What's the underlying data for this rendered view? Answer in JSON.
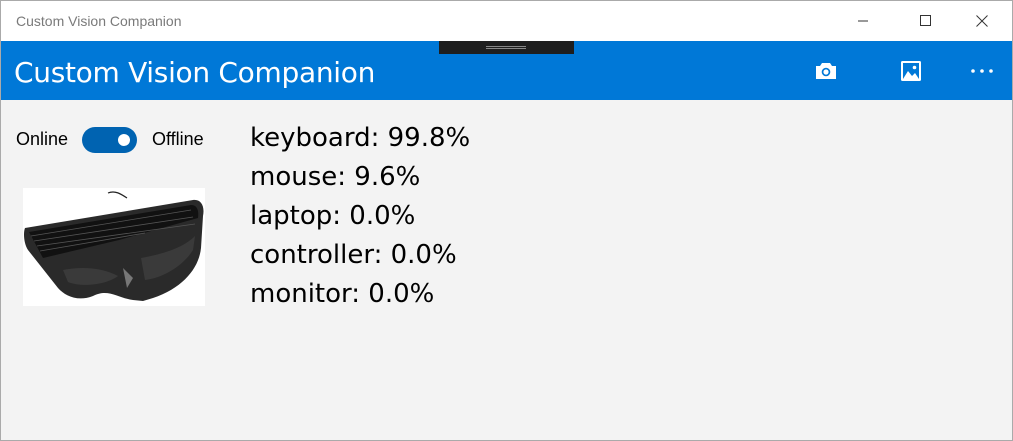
{
  "window": {
    "title": "Custom Vision Companion",
    "controls": {
      "minimize_icon": "minimize-icon",
      "maximize_icon": "maximize-icon",
      "close_icon": "close-icon"
    }
  },
  "appbar": {
    "title": "Custom Vision Companion",
    "accent": "#0078d7",
    "buttons": {
      "camera_icon": "camera-icon",
      "gallery_icon": "gallery-icon",
      "more_icon": "more-icon"
    }
  },
  "mode": {
    "online_label": "Online",
    "offline_label": "Offline",
    "toggle_on": true
  },
  "preview": {
    "image": "keyboard-image"
  },
  "results": [
    {
      "text": "keyboard: 99.8%"
    },
    {
      "text": "mouse: 9.6%"
    },
    {
      "text": "laptop: 0.0%"
    },
    {
      "text": "controller: 0.0%"
    },
    {
      "text": "monitor: 0.0%"
    }
  ]
}
